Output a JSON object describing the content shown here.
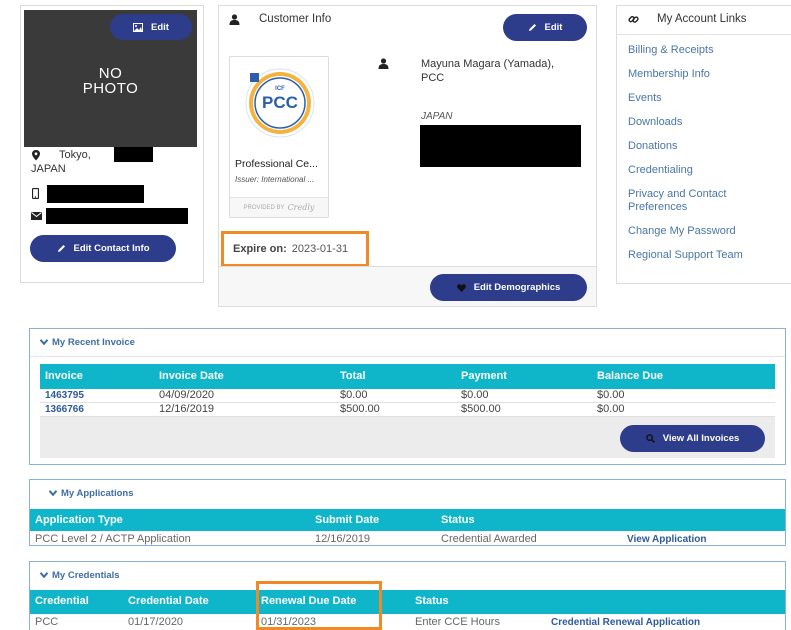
{
  "photo_card": {
    "edit_label": "Edit",
    "no_photo_line1": "NO",
    "no_photo_line2": "PHOTO",
    "city": "Tokyo,",
    "country": "JAPAN",
    "edit_contact_label": "Edit Contact Info"
  },
  "customer_info": {
    "title": "Customer Info",
    "edit_label": "Edit",
    "name_line1": "Mayuna Magara (Yamada),",
    "name_line2": "PCC",
    "country": "JAPAN",
    "badge": {
      "emblem_text": "PCC",
      "emblem_small": "ICF",
      "title": "Professional Ce...",
      "issuer": "Issuer: International ...",
      "provided_by": "PROVIDED BY",
      "provider": "Credly"
    },
    "expire_label": "Expire on:",
    "expire_value": "2023-01-31",
    "edit_demographics_label": "Edit Demographics"
  },
  "account_links": {
    "title": "My Account Links",
    "items": [
      {
        "label": "Billing & Receipts"
      },
      {
        "label": "Membership Info"
      },
      {
        "label": "Events"
      },
      {
        "label": "Downloads"
      },
      {
        "label": "Donations"
      },
      {
        "label": "Credentialing"
      },
      {
        "label": "Privacy and Contact Preferences"
      },
      {
        "label": "Change My Password"
      },
      {
        "label": "Regional Support Team"
      }
    ]
  },
  "recent_invoice": {
    "title": "My Recent Invoice",
    "columns": [
      "Invoice",
      "Invoice Date",
      "Total",
      "Payment",
      "Balance Due"
    ],
    "rows": [
      {
        "invoice": "1463795",
        "date": "04/09/2020",
        "total": "$0.00",
        "payment": "$0.00",
        "balance": "$0.00"
      },
      {
        "invoice": "1366766",
        "date": "12/16/2019",
        "total": "$500.00",
        "payment": "$500.00",
        "balance": "$0.00"
      }
    ],
    "view_all_label": "View All Invoices"
  },
  "applications": {
    "title": "My Applications",
    "columns": [
      "Application Type",
      "Submit Date",
      "Status"
    ],
    "rows": [
      {
        "type": "PCC Level 2 / ACTP Application",
        "date": "12/16/2019",
        "status": "Credential Awarded",
        "action": "View Application"
      }
    ]
  },
  "credentials": {
    "title": "My Credentials",
    "columns": [
      "Credential",
      "Credential Date",
      "Renewal Due Date",
      "Status"
    ],
    "rows": [
      {
        "credential": "PCC",
        "date": "01/17/2020",
        "renewal": "01/31/2023",
        "status": "Enter CCE Hours",
        "action": "Credential Renewal Application"
      }
    ]
  },
  "colors": {
    "brand_button": "#2e3c8c",
    "table_header": "#0fb5c8",
    "link": "#4a76a8",
    "highlight": "#f08a24"
  }
}
